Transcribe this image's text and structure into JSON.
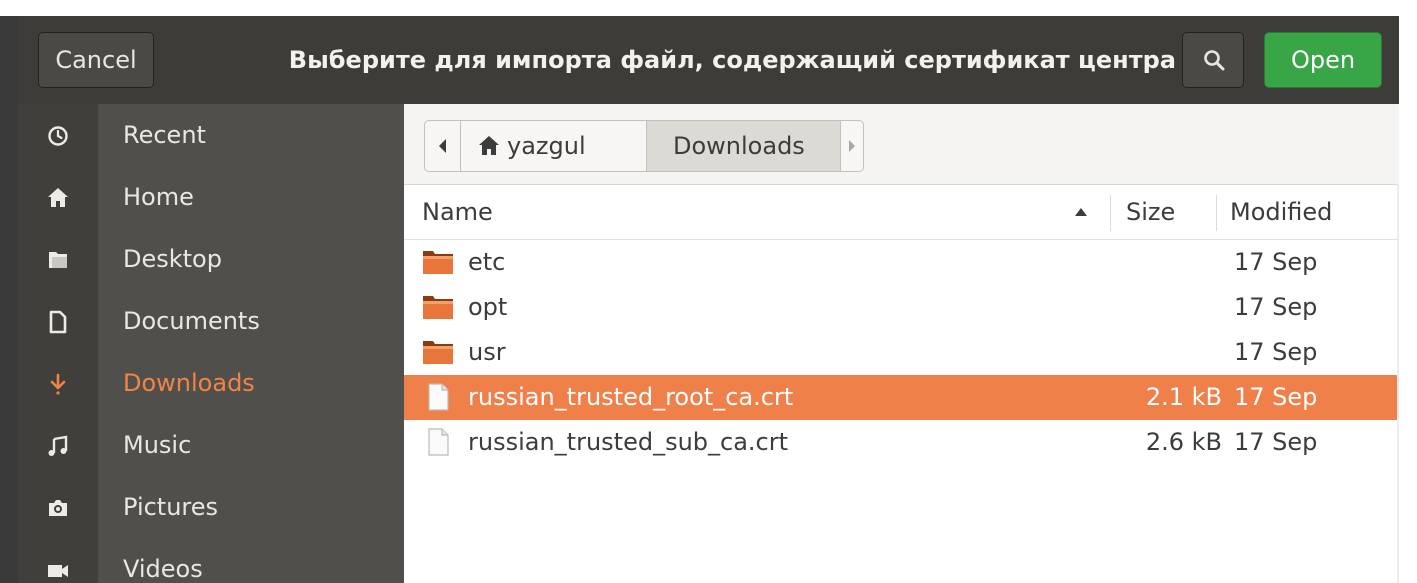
{
  "header": {
    "cancel_label": "Cancel",
    "title": "Выберите для импорта файл, содержащий сертификат центра",
    "search_icon": "search-icon",
    "open_label": "Open",
    "accent_open": "#38a546"
  },
  "sidebar": {
    "items": [
      {
        "label": "Recent",
        "icon": "clock-icon"
      },
      {
        "label": "Home",
        "icon": "home-icon"
      },
      {
        "label": "Desktop",
        "icon": "folder-icon"
      },
      {
        "label": "Documents",
        "icon": "document-icon"
      },
      {
        "label": "Downloads",
        "icon": "download-icon",
        "active": true
      },
      {
        "label": "Music",
        "icon": "music-icon"
      },
      {
        "label": "Pictures",
        "icon": "camera-icon"
      },
      {
        "label": "Videos",
        "icon": "video-icon"
      }
    ],
    "active_color": "#f08448"
  },
  "pathbar": {
    "home_label": "yazgul",
    "current_label": "Downloads"
  },
  "list": {
    "columns": {
      "name": "Name",
      "size": "Size",
      "modified": "Modified"
    },
    "sort": "name-ascending",
    "rows": [
      {
        "name": "etc",
        "size": "",
        "modified": "17 Sep",
        "type": "folder"
      },
      {
        "name": "opt",
        "size": "",
        "modified": "17 Sep",
        "type": "folder"
      },
      {
        "name": "usr",
        "size": "",
        "modified": "17 Sep",
        "type": "folder"
      },
      {
        "name": "russian_trusted_root_ca.crt",
        "size": "2.1 kB",
        "modified": "17 Sep",
        "type": "file",
        "selected": true
      },
      {
        "name": "russian_trusted_sub_ca.crt",
        "size": "2.6 kB",
        "modified": "17 Sep",
        "type": "file"
      }
    ],
    "selection_color": "#f0804a"
  }
}
